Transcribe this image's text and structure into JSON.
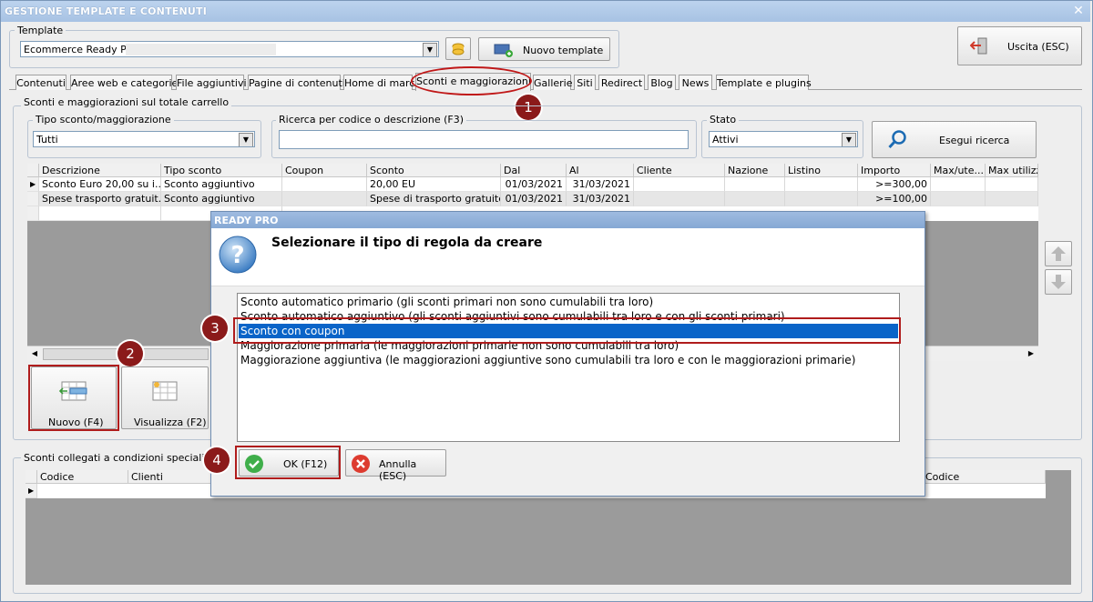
{
  "window": {
    "title": "GESTIONE TEMPLATE E CONTENUTI",
    "close_glyph": "✕"
  },
  "template": {
    "legend": "Template",
    "selected": "Ecommerce Ready Pro",
    "new_label": "Nuovo template"
  },
  "exit_label": "Uscita (ESC)",
  "tabs": [
    "Contenuti",
    "Aree web e categorie",
    "File aggiuntivi",
    "Pagine di contenuti",
    "Home di marca",
    "Sconti e maggiorazioni",
    "Gallerie",
    "Siti",
    "Redirect",
    "Blog",
    "News",
    "Template e plugins"
  ],
  "active_tab": "Sconti e maggiorazioni",
  "section_cart": {
    "legend": "Sconti e maggiorazioni sul totale carrello",
    "type_legend": "Tipo sconto/maggiorazione",
    "type_value": "Tutti",
    "search_legend": "Ricerca per codice o descrizione (F3)",
    "search_value": "",
    "status_legend": "Stato",
    "status_value": "Attivi",
    "search_button": "Esegui ricerca"
  },
  "grid": {
    "columns": [
      "Descrizione",
      "Tipo sconto",
      "Coupon",
      "Sconto",
      "Dal",
      "Al",
      "Cliente",
      "Nazione",
      "Listino",
      "Importo",
      "Max/ute...",
      "Max utilizzi"
    ],
    "rows": [
      [
        "Sconto Euro 20,00 su i...",
        "Sconto aggiuntivo",
        "",
        "20,00 EU",
        "01/03/2021",
        "31/03/2021",
        "",
        "",
        "",
        ">=300,00",
        "",
        ""
      ],
      [
        "Spese trasporto gratuit...",
        "Sconto aggiuntivo",
        "",
        "Spese di trasporto gratuite",
        "01/03/2021",
        "31/03/2021",
        "",
        "",
        "",
        ">=100,00",
        "",
        ""
      ]
    ]
  },
  "buttons": {
    "new": "Nuovo (F4)",
    "view": "Visualizza (F2)"
  },
  "section_special": {
    "legend": "Sconti collegati a condizioni speciali di vendita",
    "columns": [
      "Codice",
      "Clienti",
      "Codice"
    ]
  },
  "dialog": {
    "title": "READY PRO",
    "heading": "Selezionare il tipo di regola da creare",
    "options": [
      "Sconto automatico primario (gli sconti primari non sono cumulabili tra loro)",
      "Sconto automatico aggiuntivo (gli sconti aggiuntivi sono cumulabili tra loro e con gli sconti primari)",
      "Sconto con coupon",
      "Maggiorazione primaria (le maggiorazioni primarie non sono cumulabili tra loro)",
      "Maggiorazione aggiuntiva (le maggiorazioni aggiuntive sono cumulabili tra loro e con le maggiorazioni primarie)"
    ],
    "selected_index": 2,
    "ok": "OK (F12)",
    "cancel": "Annulla (ESC)"
  },
  "callouts": [
    "1",
    "2",
    "3",
    "4"
  ],
  "colors": {
    "accent": "#0a64c8",
    "callout": "#8b1a1a",
    "highlight_border": "#b01c1c"
  }
}
